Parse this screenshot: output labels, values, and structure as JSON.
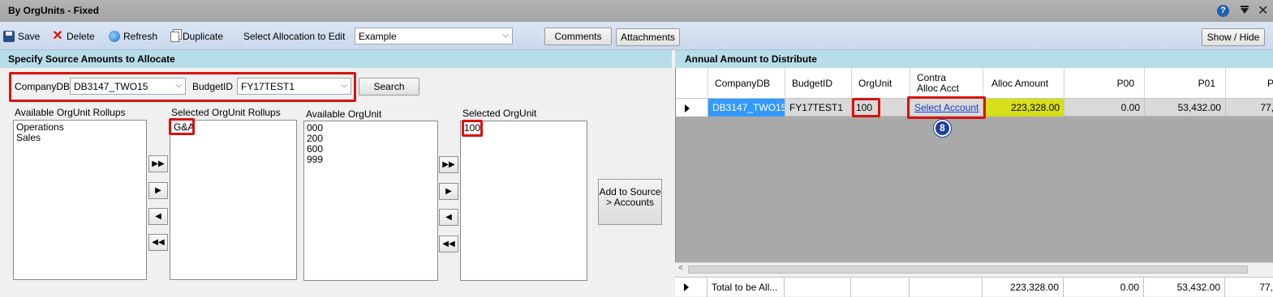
{
  "window": {
    "title": "By OrgUnits - Fixed",
    "help_glyph": "?"
  },
  "toolbar": {
    "save": "Save",
    "delete": "Delete",
    "refresh": "Refresh",
    "duplicate": "Duplicate",
    "select_allocation_label": "Select Allocation to Edit",
    "allocation_value": "Example",
    "comments": "Comments",
    "attachments": "Attachments",
    "show_hide": "Show / Hide"
  },
  "left_panel": {
    "header": "Specify Source Amounts to Allocate",
    "company_label": "CompanyDB",
    "company_value": "DB3147_TWO15",
    "budget_label": "BudgetID",
    "budget_value": "FY17TEST1",
    "search": "Search",
    "available_rollups_label": "Available OrgUnit Rollups",
    "available_rollups": [
      "Operations",
      "Sales"
    ],
    "selected_rollups_label": "Selected OrgUnit Rollups",
    "selected_rollups": [
      "G&A"
    ],
    "available_orgunit_label": "Available OrgUnit",
    "available_orgunits": [
      "000",
      "200",
      "600",
      "999"
    ],
    "selected_orgunit_label": "Selected OrgUnit",
    "selected_orgunits": [
      "100"
    ],
    "move_buttons": [
      "▶▶",
      "▶",
      "◀",
      "◀◀"
    ],
    "add_to_source": "Add to Source > Accounts"
  },
  "right_panel": {
    "header": "Annual Amount to Distribute",
    "columns": [
      "CompanyDB",
      "BudgetID",
      "OrgUnit",
      "Contra Alloc Acct",
      "Alloc Amount",
      "P00",
      "P01",
      "P"
    ],
    "row": {
      "company": "DB3147_TWO15",
      "budget": "FY17TEST1",
      "orgunit": "100",
      "contra": "Select Account",
      "alloc_amount": "223,328.00",
      "p00": "0.00",
      "p01": "53,432.00",
      "p02": "77,"
    },
    "badge": "8",
    "totals": {
      "label": "Total to be All...",
      "alloc_amount": "223,328.00",
      "p00": "0.00",
      "p01": "53,432.00",
      "p02": "77,"
    }
  },
  "colors": {
    "header_band": "#b7dde8",
    "highlight_red": "#d9120f",
    "selected_cell": "#3399ff",
    "alloc_highlight": "#d7de1a"
  }
}
